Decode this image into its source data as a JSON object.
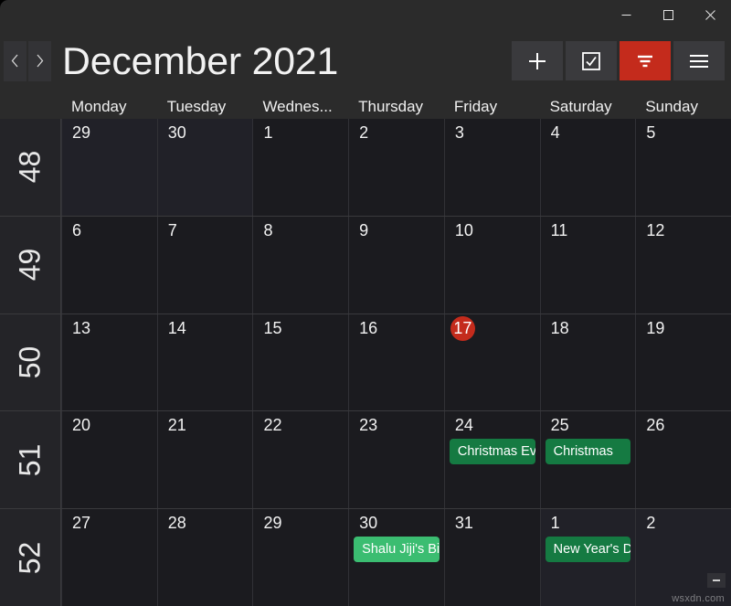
{
  "window": {
    "controls": [
      {
        "name": "minimize",
        "glyph": "minimize-icon"
      },
      {
        "name": "maximize",
        "glyph": "maximize-icon"
      },
      {
        "name": "close",
        "glyph": "close-icon"
      }
    ]
  },
  "header": {
    "title": "December 2021",
    "prev_label": "‹",
    "next_label": "›",
    "toolbar": [
      {
        "id": "add",
        "icon": "plus-icon",
        "accent": false
      },
      {
        "id": "tasks",
        "icon": "checkbox-check-icon",
        "accent": false
      },
      {
        "id": "filter",
        "icon": "filter-icon",
        "accent": true
      },
      {
        "id": "menu",
        "icon": "hamburger-menu-icon",
        "accent": false
      }
    ]
  },
  "colors": {
    "accent_red": "#c42b1c",
    "today_red": "#c42b1c",
    "event_green_dark": "#157a42",
    "event_green_light": "#3bbd71",
    "window_chrome": "#2b2b2b",
    "cell_bg": "#1b1b1f",
    "cell_bg_other_month": "#212128",
    "grid_line": "#3a3a3d"
  },
  "weekday_headers": [
    "Monday",
    "Tuesday",
    "Wednes...",
    "Thursday",
    "Friday",
    "Saturday",
    "Sunday"
  ],
  "weeks": [
    {
      "week_number": "48",
      "days": [
        {
          "num": "29",
          "other_month": true,
          "today": false,
          "events": []
        },
        {
          "num": "30",
          "other_month": true,
          "today": false,
          "events": []
        },
        {
          "num": "1",
          "other_month": false,
          "today": false,
          "events": []
        },
        {
          "num": "2",
          "other_month": false,
          "today": false,
          "events": []
        },
        {
          "num": "3",
          "other_month": false,
          "today": false,
          "events": []
        },
        {
          "num": "4",
          "other_month": false,
          "today": false,
          "events": []
        },
        {
          "num": "5",
          "other_month": false,
          "today": false,
          "events": []
        }
      ]
    },
    {
      "week_number": "49",
      "days": [
        {
          "num": "6",
          "other_month": false,
          "today": false,
          "events": []
        },
        {
          "num": "7",
          "other_month": false,
          "today": false,
          "events": []
        },
        {
          "num": "8",
          "other_month": false,
          "today": false,
          "events": []
        },
        {
          "num": "9",
          "other_month": false,
          "today": false,
          "events": []
        },
        {
          "num": "10",
          "other_month": false,
          "today": false,
          "events": []
        },
        {
          "num": "11",
          "other_month": false,
          "today": false,
          "events": []
        },
        {
          "num": "12",
          "other_month": false,
          "today": false,
          "events": []
        }
      ]
    },
    {
      "week_number": "50",
      "days": [
        {
          "num": "13",
          "other_month": false,
          "today": false,
          "events": []
        },
        {
          "num": "14",
          "other_month": false,
          "today": false,
          "events": []
        },
        {
          "num": "15",
          "other_month": false,
          "today": false,
          "events": []
        },
        {
          "num": "16",
          "other_month": false,
          "today": false,
          "events": []
        },
        {
          "num": "17",
          "other_month": false,
          "today": true,
          "events": []
        },
        {
          "num": "18",
          "other_month": false,
          "today": false,
          "events": []
        },
        {
          "num": "19",
          "other_month": false,
          "today": false,
          "events": []
        }
      ]
    },
    {
      "week_number": "51",
      "days": [
        {
          "num": "20",
          "other_month": false,
          "today": false,
          "events": []
        },
        {
          "num": "21",
          "other_month": false,
          "today": false,
          "events": []
        },
        {
          "num": "22",
          "other_month": false,
          "today": false,
          "events": []
        },
        {
          "num": "23",
          "other_month": false,
          "today": false,
          "events": []
        },
        {
          "num": "24",
          "other_month": false,
          "today": false,
          "events": [
            {
              "label": "Christmas Ev",
              "color": "#157a42"
            }
          ]
        },
        {
          "num": "25",
          "other_month": false,
          "today": false,
          "events": [
            {
              "label": "Christmas",
              "color": "#157a42"
            }
          ]
        },
        {
          "num": "26",
          "other_month": false,
          "today": false,
          "events": []
        }
      ]
    },
    {
      "week_number": "52",
      "days": [
        {
          "num": "27",
          "other_month": false,
          "today": false,
          "events": []
        },
        {
          "num": "28",
          "other_month": false,
          "today": false,
          "events": []
        },
        {
          "num": "29",
          "other_month": false,
          "today": false,
          "events": []
        },
        {
          "num": "30",
          "other_month": false,
          "today": false,
          "events": [
            {
              "label": "Shalu Jiji's Bi",
              "color": "#3bbd71"
            }
          ]
        },
        {
          "num": "31",
          "other_month": false,
          "today": false,
          "events": []
        },
        {
          "num": "1",
          "other_month": true,
          "today": false,
          "events": [
            {
              "label": "New Year's D",
              "color": "#157a42"
            }
          ]
        },
        {
          "num": "2",
          "other_month": true,
          "today": false,
          "events": []
        }
      ]
    }
  ],
  "footer": {
    "watermark": "wsxdn.com"
  }
}
